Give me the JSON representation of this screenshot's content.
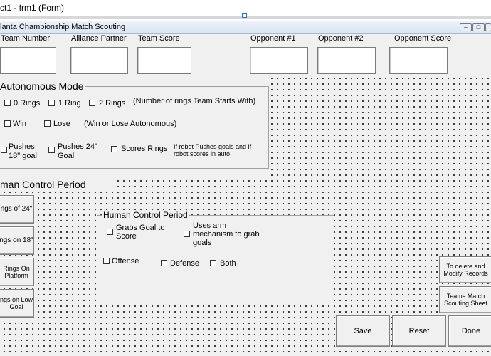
{
  "ide": {
    "title": "ct1 - frm1 (Form)"
  },
  "form": {
    "caption": "lanta Championship Match Scouting",
    "min_icon": "minimize-icon",
    "max_icon": "maximize-icon",
    "close_icon": "close-icon"
  },
  "top_fields": {
    "team_number": "Team Number",
    "alliance_partner": "Alliance Partner",
    "team_score": "Team Score",
    "opponent1": "Opponent #1",
    "opponent2": "Opponent #2",
    "opponent_score": "Opponent Score"
  },
  "autonomous": {
    "title": "Autonomous Mode",
    "rings0": "0 Rings",
    "ring1": "1 Ring",
    "rings2": "2 Rings",
    "rings_note": "(Number of rings Team Starts With)",
    "win": "Win",
    "lose": "Lose",
    "win_note": "(Win or Lose Autonomous)",
    "pushes18": "Pushes 18\" goal",
    "pushes24": "Pushes 24\" Goal",
    "scores_rings": "Scores Rings",
    "push_note": "If robot Pushes goals and if robot scores in auto"
  },
  "human": {
    "title": "man Control Period",
    "frame_title": "Human Control Period",
    "grabs_goal": "Grabs Goal to Score",
    "uses_arm": "Uses arm mechanism to grab goals",
    "offense": "Offense",
    "defense": "Defense",
    "both": "Both"
  },
  "left_buttons": {
    "b1": "ngs of 24\"",
    "b2": "ngs on 18\"",
    "b3": "Rings On Platform",
    "b4": "ngs on Low Goal"
  },
  "right_buttons": {
    "modify": "To delete and Modify Records",
    "sheet": "Teams Match Scouting Sheet"
  },
  "bottom_buttons": {
    "save": "Save",
    "reset": "Reset",
    "done": "Done"
  }
}
